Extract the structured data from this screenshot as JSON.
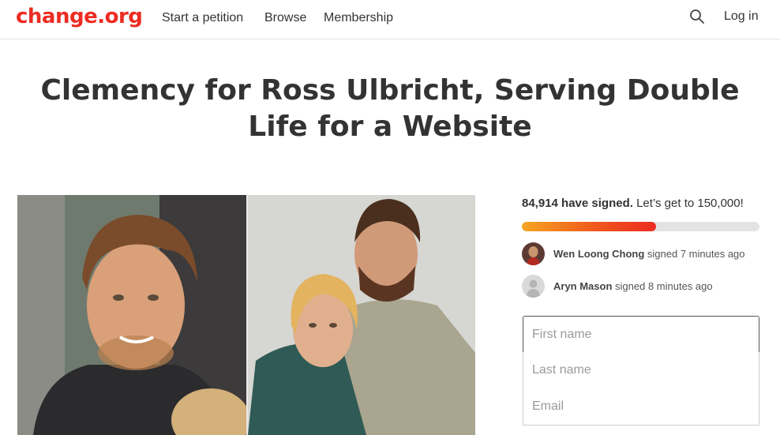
{
  "header": {
    "logo": "change.org",
    "nav": [
      "Start a petition",
      "Browse",
      "Membership"
    ],
    "login": "Log in",
    "brand_color": "#ec2c22"
  },
  "petition": {
    "title": "Clemency for Ross Ulbricht, Serving Double Life for a Website"
  },
  "signatures": {
    "count_text": "84,914 have signed.",
    "goal_text": "Let’s get to 150,000!",
    "count": 84914,
    "goal": 150000,
    "progress_fraction": 0.566
  },
  "recent_signers": [
    {
      "name": "Wen Loong Chong",
      "action": "signed 7 minutes ago",
      "avatar": "photo-avatar"
    },
    {
      "name": "Aryn Mason",
      "action": "signed 8 minutes ago",
      "avatar": "default-person-avatar"
    }
  ],
  "form": {
    "first_name_placeholder": "First name",
    "last_name_placeholder": "Last name",
    "email_placeholder": "Email"
  }
}
